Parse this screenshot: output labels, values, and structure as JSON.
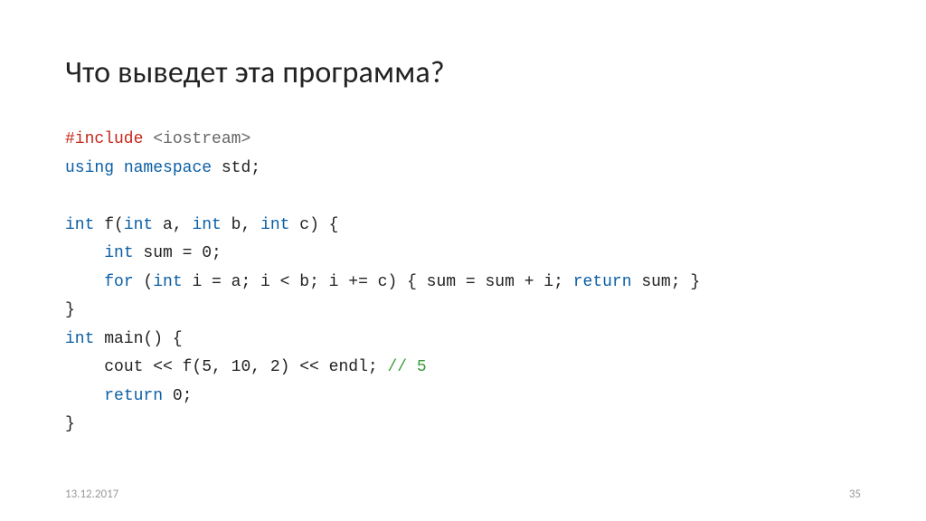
{
  "title": "Что выведет эта программа?",
  "code": {
    "l1_kw": "#include",
    "l1_tgt": " <iostream>",
    "l2_kw1": "using",
    "l2_sp1": " ",
    "l2_kw2": "namespace",
    "l2_rest": " std;",
    "l3_kw1": "int",
    "l3_mid1": " f(",
    "l3_kw2": "int",
    "l3_mid2": " a, ",
    "l3_kw3": "int",
    "l3_mid3": " b, ",
    "l3_kw4": "int",
    "l3_rest": " c) {",
    "l4_indent": "    ",
    "l4_kw": "int",
    "l4_rest": " sum = 0;",
    "l5_indent": "    ",
    "l5_kw1": "for",
    "l5_mid1": " (",
    "l5_kw2": "int",
    "l5_mid2": " i = a; i < b; i += c) { sum = sum + i; ",
    "l5_kw3": "return",
    "l5_rest": " sum; }",
    "l6": "}",
    "l7_kw": "int",
    "l7_rest": " main() {",
    "l8_indent": "    ",
    "l8_mid": "cout << f(5, 10, 2) << endl; ",
    "l8_comment": "// 5",
    "l9_indent": "    ",
    "l9_kw": "return",
    "l9_rest": " 0;",
    "l10": "}"
  },
  "footer": {
    "date": "13.12.2017",
    "page": "35"
  }
}
